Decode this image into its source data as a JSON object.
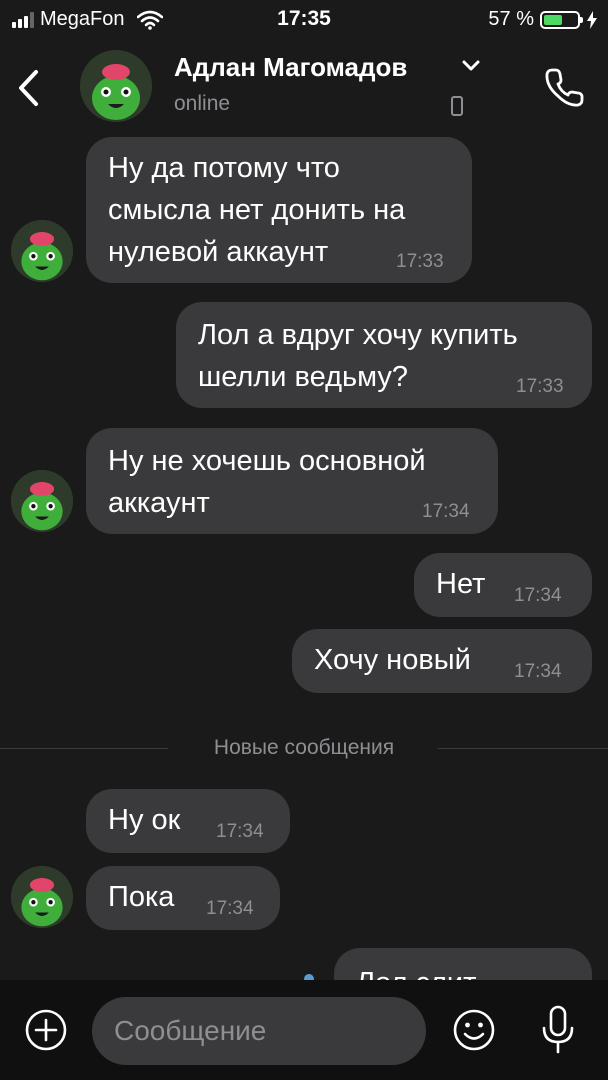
{
  "status_bar": {
    "carrier": "MegaFon",
    "time": "17:35",
    "battery_percent": "57 %",
    "battery_level": 0.57,
    "accent_color": "#4cd964"
  },
  "header": {
    "contact_name": "Адлан Магомадов",
    "presence": "online",
    "icons": [
      "chevron-left-icon",
      "chevron-down-icon",
      "mobile-device-icon",
      "phone-icon"
    ]
  },
  "messages": [
    {
      "direction": "incoming",
      "text": "Ну да потому что\nсмысла нет донить на\nнулевой аккаунт",
      "time": "17:33"
    },
    {
      "direction": "outgoing",
      "text": "Лол а вдруг хочу купить\nшелли ведьму?",
      "time": "17:33"
    },
    {
      "direction": "incoming",
      "text": "Ну не хочешь основной\nаккаунт",
      "time": "17:34"
    },
    {
      "direction": "outgoing",
      "text": "Нет",
      "time": "17:34"
    },
    {
      "direction": "outgoing",
      "text": "Хочу новый",
      "time": "17:34"
    },
    {
      "direction": "incoming",
      "text": "Ну ок",
      "time": "17:34"
    },
    {
      "direction": "incoming",
      "text": "Пока",
      "time": "17:34"
    },
    {
      "direction": "outgoing",
      "text": "Лол слит",
      "time": ""
    }
  ],
  "new_messages_label": "Новые сообщения",
  "input": {
    "placeholder": "Сообщение",
    "value": "",
    "icons": [
      "plus-circle-icon",
      "emoji-icon",
      "microphone-icon"
    ]
  }
}
